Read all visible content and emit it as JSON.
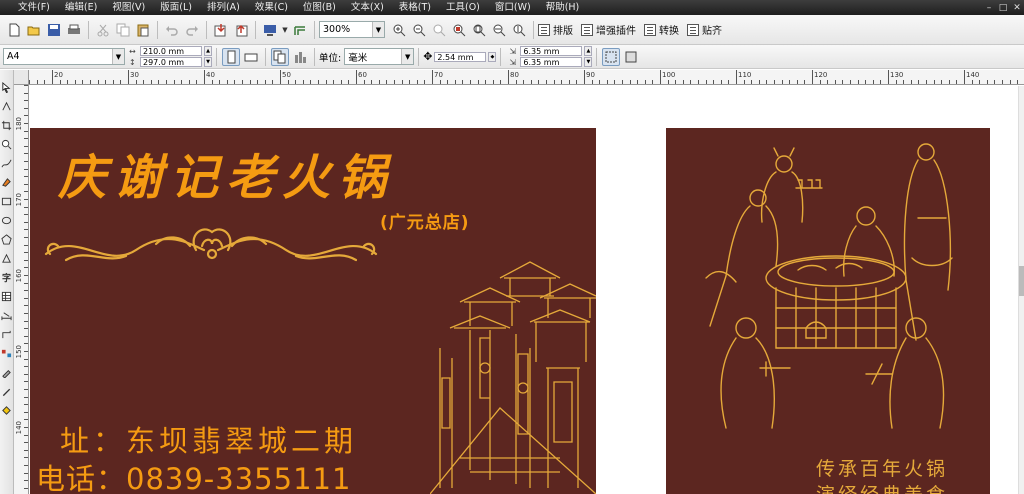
{
  "menu": [
    "文件(F)",
    "编辑(E)",
    "视图(V)",
    "版面(L)",
    "排列(A)",
    "效果(C)",
    "位图(B)",
    "文本(X)",
    "表格(T)",
    "工具(O)",
    "窗口(W)",
    "帮助(H)"
  ],
  "window_buttons": [
    "–",
    "□",
    "✕"
  ],
  "toolbar": {
    "zoom": "300%",
    "plugins": [
      "排版",
      "增强插件",
      "转换",
      "贴齐"
    ]
  },
  "propbar": {
    "page_size": "A4",
    "width": "210.0 mm",
    "height": "297.0 mm",
    "unit_label": "单位:",
    "unit": "毫米",
    "nudge": "2.54 mm",
    "dup_x": "6.35 mm",
    "dup_y": "6.35 mm"
  },
  "ruler": {
    "h_labels": [
      "20",
      "30",
      "40",
      "50",
      "60",
      "70",
      "80",
      "90",
      "100",
      "110",
      "120",
      "130",
      "140"
    ],
    "v_labels": [
      "180",
      "170",
      "160",
      "150",
      "140"
    ]
  },
  "front": {
    "title": "庆谢记老火锅",
    "branch": "(广元总店)",
    "address": "址：东坝翡翠城二期",
    "phone": "电话：0839-3355111"
  },
  "back": {
    "slogan1": "传承百年火锅",
    "slogan2": "演绎经典美食"
  },
  "colors": {
    "card_bg": "#5c2620",
    "title_orange": "#f59b12",
    "line_art_gold": "#e5a93a"
  }
}
